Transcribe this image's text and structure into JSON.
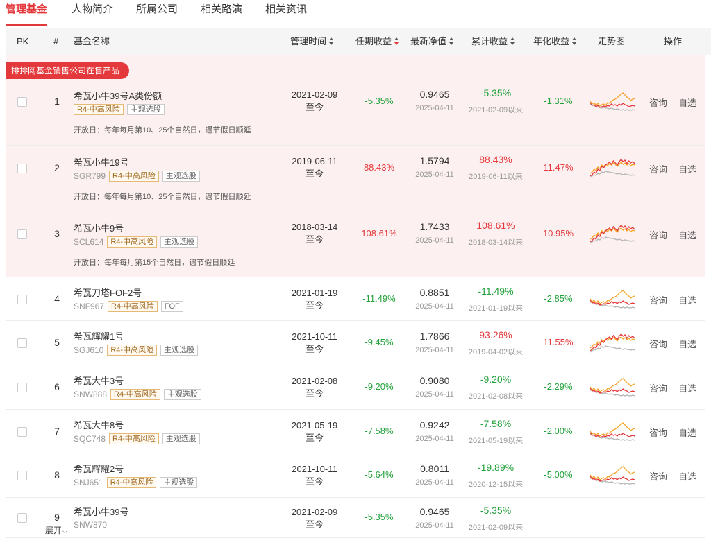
{
  "tabs": [
    {
      "label": "管理基金"
    },
    {
      "label": "人物简介"
    },
    {
      "label": "所属公司"
    },
    {
      "label": "相关路演"
    },
    {
      "label": "相关资讯"
    }
  ],
  "header": {
    "pk": "PK",
    "num": "#",
    "name": "基金名称",
    "manage_time": "管理时间",
    "term_return": "任期收益",
    "latest_nav": "最新净值",
    "cum_return": "累计收益",
    "annual_return": "年化收益",
    "trend": "走势图",
    "ops": "操作"
  },
  "promo": {
    "banner": "排排网基金销售公司在售产品"
  },
  "ops": {
    "consult": "咨询",
    "watch": "自选"
  },
  "expand_label": "展开",
  "colors": {
    "accent": "#e4393c",
    "up": "#e4393c",
    "down": "#21a13a",
    "promo_bg": "#fdf0f0",
    "risk_tag": "#e7b977",
    "spark_orange": "#f4a62a",
    "spark_red": "#e4393c",
    "spark_gray": "#b5b5b5"
  },
  "rows": [
    {
      "index": "1",
      "name": "希瓦小牛39号A类份额",
      "code": "",
      "risk": "R4-中高风险",
      "type": "主观选股",
      "open_day": "开放日：每年每月第10、25个自然日，遇节假日顺延",
      "start": "2021-02-09",
      "end": "至今",
      "term": "-5.35%",
      "term_dir": "down",
      "nav": "0.9465",
      "nav_date": "2025-04-11",
      "cum": "-5.35%",
      "cum_dir": "down",
      "cum_since": "2021-02-09以来",
      "annual": "-1.31%",
      "annual_dir": "down",
      "trend": "orange-high",
      "promo": true
    },
    {
      "index": "2",
      "name": "希瓦小牛19号",
      "code": "SGR799",
      "risk": "R4-中高风险",
      "type": "主观选股",
      "open_day": "开放日：每年每月第10、25个自然日，遇节假日顺延",
      "start": "2019-06-11",
      "end": "至今",
      "term": "88.43%",
      "term_dir": "up",
      "nav": "1.5794",
      "nav_date": "2025-04-11",
      "cum": "88.43%",
      "cum_dir": "up",
      "cum_since": "2019-06-11以来",
      "annual": "11.47%",
      "annual_dir": "up",
      "trend": "red-high",
      "promo": true
    },
    {
      "index": "3",
      "name": "希瓦小牛9号",
      "code": "SCL614",
      "risk": "R4-中高风险",
      "type": "主观选股",
      "open_day": "开放日：每年每月第15个自然日，遇节假日顺延",
      "start": "2018-03-14",
      "end": "至今",
      "term": "108.61%",
      "term_dir": "up",
      "nav": "1.7433",
      "nav_date": "2025-04-11",
      "cum": "108.61%",
      "cum_dir": "up",
      "cum_since": "2018-03-14以来",
      "annual": "10.95%",
      "annual_dir": "up",
      "trend": "red-high",
      "promo": true
    },
    {
      "index": "4",
      "name": "希瓦刀塔FOF2号",
      "code": "SNF967",
      "risk": "R4-中高风险",
      "type": "FOF",
      "open_day": "",
      "start": "2021-01-19",
      "end": "至今",
      "term": "-11.49%",
      "term_dir": "down",
      "nav": "0.8851",
      "nav_date": "2025-04-11",
      "cum": "-11.49%",
      "cum_dir": "down",
      "cum_since": "2021-01-19以来",
      "annual": "-2.85%",
      "annual_dir": "down",
      "trend": "orange-high",
      "promo": false
    },
    {
      "index": "5",
      "name": "希瓦辉耀1号",
      "code": "SGJ610",
      "risk": "R4-中高风险",
      "type": "主观选股",
      "open_day": "",
      "start": "2021-10-11",
      "end": "至今",
      "term": "-9.45%",
      "term_dir": "down",
      "nav": "1.7866",
      "nav_date": "2025-04-11",
      "cum": "93.26%",
      "cum_dir": "up",
      "cum_since": "2019-04-02以来",
      "annual": "11.55%",
      "annual_dir": "up",
      "trend": "red-high",
      "promo": false
    },
    {
      "index": "6",
      "name": "希瓦大牛3号",
      "code": "SNW888",
      "risk": "R4-中高风险",
      "type": "主观选股",
      "open_day": "",
      "start": "2021-02-08",
      "end": "至今",
      "term": "-9.20%",
      "term_dir": "down",
      "nav": "0.9080",
      "nav_date": "2025-04-11",
      "cum": "-9.20%",
      "cum_dir": "down",
      "cum_since": "2021-02-08以来",
      "annual": "-2.29%",
      "annual_dir": "down",
      "trend": "orange-high",
      "promo": false
    },
    {
      "index": "7",
      "name": "希瓦大牛8号",
      "code": "SQC748",
      "risk": "R4-中高风险",
      "type": "主观选股",
      "open_day": "",
      "start": "2021-05-19",
      "end": "至今",
      "term": "-7.58%",
      "term_dir": "down",
      "nav": "0.9242",
      "nav_date": "2025-04-11",
      "cum": "-7.58%",
      "cum_dir": "down",
      "cum_since": "2021-05-19以来",
      "annual": "-2.00%",
      "annual_dir": "down",
      "trend": "orange-high",
      "promo": false
    },
    {
      "index": "8",
      "name": "希瓦辉耀2号",
      "code": "SNJ651",
      "risk": "R4-中高风险",
      "type": "主观选股",
      "open_day": "",
      "start": "2021-10-11",
      "end": "至今",
      "term": "-5.64%",
      "term_dir": "down",
      "nav": "0.8011",
      "nav_date": "2025-04-11",
      "cum": "-19.89%",
      "cum_dir": "down",
      "cum_since": "2020-12-15以来",
      "annual": "-5.00%",
      "annual_dir": "down",
      "trend": "orange-high",
      "promo": false
    },
    {
      "index": "9",
      "name": "希瓦小牛39号",
      "code": "SNW870",
      "risk": "",
      "type": "",
      "open_day": "",
      "start": "2021-02-09",
      "end": "至今",
      "term": "-5.35%",
      "term_dir": "down",
      "nav": "0.9465",
      "nav_date": "2025-04-11",
      "cum": "-5.35%",
      "cum_dir": "down",
      "cum_since": "2021-02-09以来",
      "annual": "",
      "annual_dir": "down",
      "trend": "",
      "promo": false
    }
  ]
}
